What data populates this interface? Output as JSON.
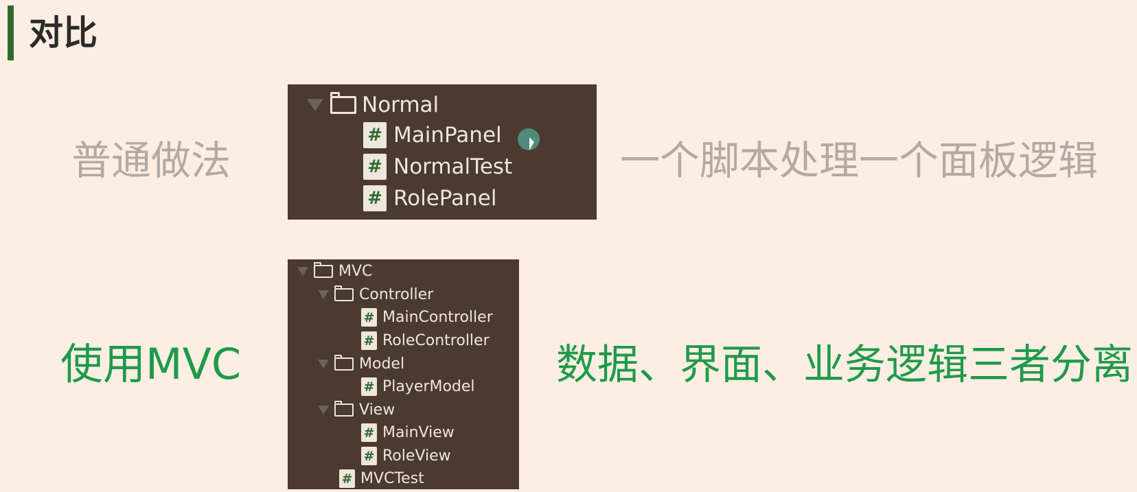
{
  "title": "对比",
  "normal": {
    "label": "普通做法",
    "description": "一个脚本处理一个面板逻辑",
    "tree": {
      "folder": "Normal",
      "files": [
        "MainPanel",
        "NormalTest",
        "RolePanel"
      ]
    }
  },
  "mvc": {
    "label": "使用MVC",
    "description": "数据、界面、业务逻辑三者分离",
    "tree": {
      "root": "MVC",
      "controller_folder": "Controller",
      "controller_files": [
        "MainController",
        "RoleController"
      ],
      "model_folder": "Model",
      "model_files": [
        "PlayerModel"
      ],
      "view_folder": "View",
      "view_files": [
        "MainView",
        "RoleView"
      ],
      "root_files": [
        "MVCTest"
      ]
    }
  },
  "icons": {
    "script": "#"
  },
  "colors": {
    "accent": "#2e6b2f",
    "highlight_green": "#1f9a4a",
    "muted_gray": "#b3aaa4",
    "panel_bg": "#4a3a2f",
    "page_bg": "#fdeee4"
  }
}
